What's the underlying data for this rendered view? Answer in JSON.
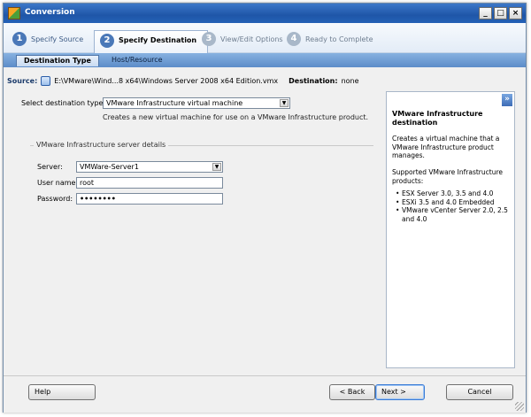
{
  "window": {
    "title": "Conversion",
    "controls": [
      "_",
      "□",
      "×"
    ]
  },
  "steps": [
    {
      "num": "1",
      "label": "Specify Source",
      "state": "done"
    },
    {
      "num": "2",
      "label": "Specify Destination",
      "state": "current"
    },
    {
      "num": "3",
      "label": "View/Edit Options",
      "state": "pending"
    },
    {
      "num": "4",
      "label": "Ready to Complete",
      "state": "pending"
    }
  ],
  "subtabs": {
    "active": "Destination Type",
    "other": "Host/Resource"
  },
  "source": {
    "label": "Source:",
    "path": "E:\\VMware\\Wind...8 x64\\Windows Server 2008 x64 Edition.vmx",
    "destination_label": "Destination:",
    "destination_value": "none"
  },
  "form": {
    "destination_type_label": "Select destination type:",
    "destination_type_value": "VMware Infrastructure virtual machine",
    "destination_type_hint": "Creates a new virtual machine for use on a VMware Infrastructure product.",
    "group_title": "VMware Infrastructure server details",
    "server_label": "Server:",
    "server_value": "VMWare-Server1",
    "username_label": "User name:",
    "username_value": "root",
    "password_label": "Password:",
    "password_value": "••••••••"
  },
  "help": {
    "collapse": "»",
    "title": "VMware Infrastructure destination",
    "desc": "Creates a virtual machine that a VMware Infrastructure product manages.",
    "supported_label": "Supported VMware Infrastructure products:",
    "items": [
      "ESX Server 3.0, 3.5 and 4.0",
      "ESXi 3.5 and 4.0 Embedded",
      "VMware vCenter Server 2.0, 2.5 and 4.0"
    ]
  },
  "buttons": {
    "help": "Help",
    "back": "< Back",
    "next": "Next >",
    "cancel": "Cancel"
  }
}
